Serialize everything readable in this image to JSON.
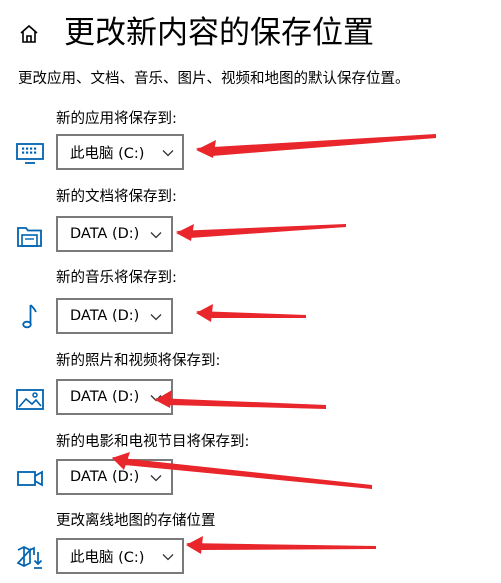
{
  "header": {
    "title": "更改新内容的保存位置",
    "description": "更改应用、文档、音乐、图片、视频和地图的默认保存位置。",
    "home_icon": "home-icon"
  },
  "locations": [
    {
      "id": "apps",
      "label": "新的应用将保存到:",
      "value": "此电脑 (C:)",
      "icon": "monitor-icon"
    },
    {
      "id": "docs",
      "label": "新的文档将保存到:",
      "value": "DATA (D:)",
      "icon": "folder-icon"
    },
    {
      "id": "music",
      "label": "新的音乐将保存到:",
      "value": "DATA (D:)",
      "icon": "music-note-icon"
    },
    {
      "id": "photos",
      "label": "新的照片和视频将保存到:",
      "value": "DATA (D:)",
      "icon": "picture-icon"
    },
    {
      "id": "movies",
      "label": "新的电影和电视节目将保存到:",
      "value": "DATA (D:)",
      "icon": "video-camera-icon"
    },
    {
      "id": "maps",
      "label": "更改离线地图的存储位置",
      "value": "此电脑 (C:)",
      "icon": "map-download-icon"
    }
  ],
  "colors": {
    "accent": "#0063b1",
    "annotation_arrow": "#e8262b",
    "select_border": "#7a7a7a"
  }
}
